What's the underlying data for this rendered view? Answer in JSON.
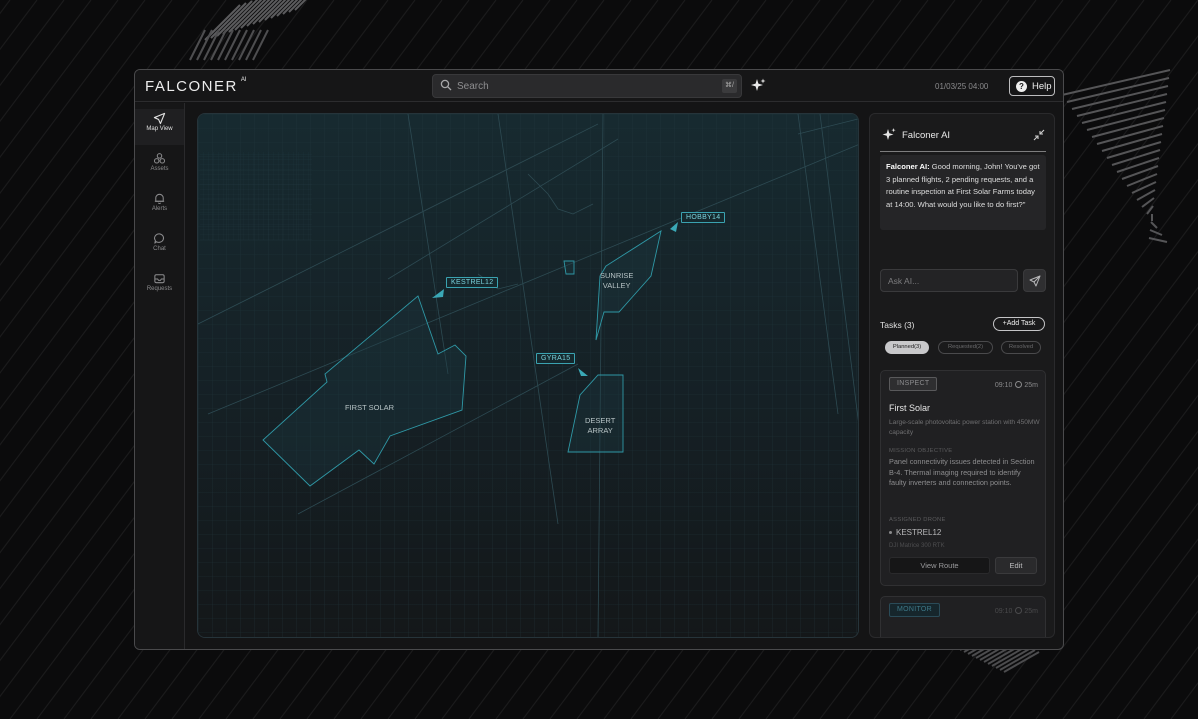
{
  "app": {
    "logo": "FALCONER",
    "logo_sup": "AI"
  },
  "search": {
    "placeholder": "Search",
    "shortcut": "⌘/"
  },
  "header": {
    "datetime": "01/03/25 04:00",
    "help_label": "Help"
  },
  "sidebar": {
    "items": [
      {
        "label": "Map View",
        "icon": "plane-icon",
        "active": true
      },
      {
        "label": "Assets",
        "icon": "assets-icon",
        "active": false
      },
      {
        "label": "Alerts",
        "icon": "bell-icon",
        "active": false
      },
      {
        "label": "Chat",
        "icon": "chat-icon",
        "active": false
      },
      {
        "label": "Requests",
        "icon": "inbox-icon",
        "active": false
      }
    ]
  },
  "map": {
    "areas": [
      {
        "label_line1": "FIRST SOLAR",
        "label_line2": ""
      },
      {
        "label_line1": "SUNRISE",
        "label_line2": "VALLEY"
      },
      {
        "label_line1": "DESERT",
        "label_line2": "ARRAY"
      }
    ],
    "drones": [
      {
        "label": "HOBBY14"
      },
      {
        "label": "KESTREL12"
      },
      {
        "label": "GYRA15"
      }
    ],
    "colors": {
      "accent": "#3aa2b0",
      "fill": "#1c3a42",
      "background": "#162126"
    }
  },
  "ai_panel": {
    "title": "Falconer AI",
    "message_sender": "Falconer AI:",
    "message_text": " Good morning, John! You've got 3 planned flights, 2 pending requests, and a routine inspection at First Solar Farms today at 14:00. What would you like to do first?\"",
    "ask_placeholder": "Ask AI..."
  },
  "tasks": {
    "title": "Tasks (3)",
    "add_label": "+Add Task",
    "filters": [
      {
        "label": "Planned(3)",
        "active": true
      },
      {
        "label": "Requested(2)",
        "active": false
      },
      {
        "label": "Resolved",
        "active": false
      }
    ],
    "cards": [
      {
        "type": "INSPECT",
        "time": "09:10",
        "duration": "25m",
        "title": "First Solar",
        "description": "Large-scale photovoltaic power station with 450MW capacity",
        "objective_label": "MISSION OBJECTIVE",
        "objective": "Panel connectivity issues detected in Section B-4. Thermal imaging required to identify faulty inverters and connection points.",
        "drone_label": "ASSIGNED DRONE",
        "drone": "KESTREL12",
        "drone_model": "DJI Matrice 300 RTK",
        "view_route_label": "View Route",
        "edit_label": "Edit"
      },
      {
        "type": "MONITOR",
        "time": "09:10",
        "duration": "25m"
      }
    ]
  }
}
